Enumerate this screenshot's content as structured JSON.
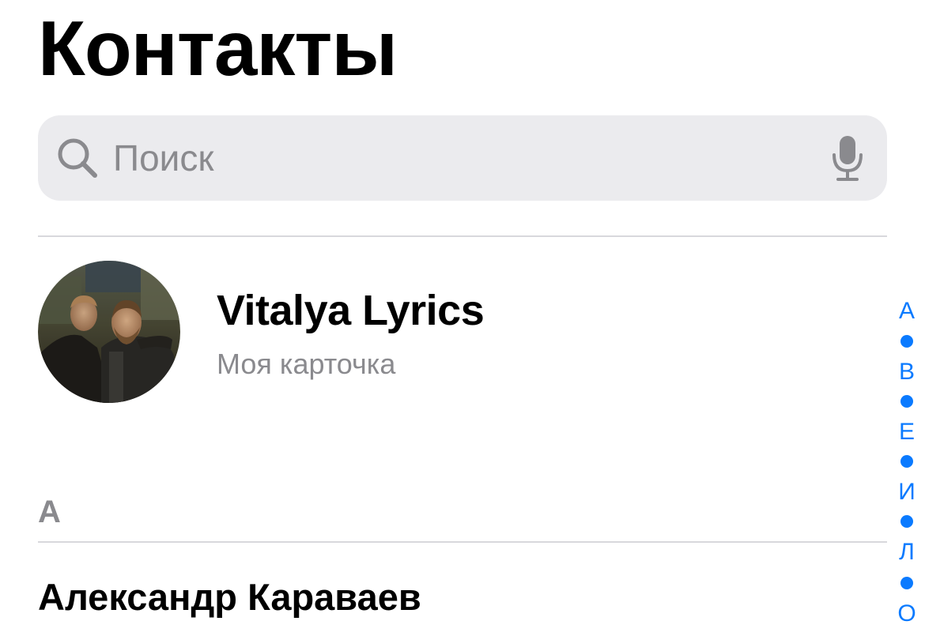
{
  "header": {
    "title": "Контакты"
  },
  "search": {
    "placeholder": "Поиск",
    "value": "",
    "icon": "search-icon",
    "mic_icon": "microphone-icon"
  },
  "my_card": {
    "name": "Vitalya Lyrics",
    "subtitle": "Моя карточка"
  },
  "sections": [
    {
      "letter": "А",
      "contacts": [
        {
          "name": "Александр Караваев"
        }
      ]
    }
  ],
  "index": [
    "А",
    "В",
    "Е",
    "И",
    "Л",
    "О"
  ],
  "colors": {
    "accent": "#0a7aff",
    "secondary_text": "#8a8a8e",
    "search_bg": "#ebebee",
    "separator": "#d8d8dc"
  }
}
